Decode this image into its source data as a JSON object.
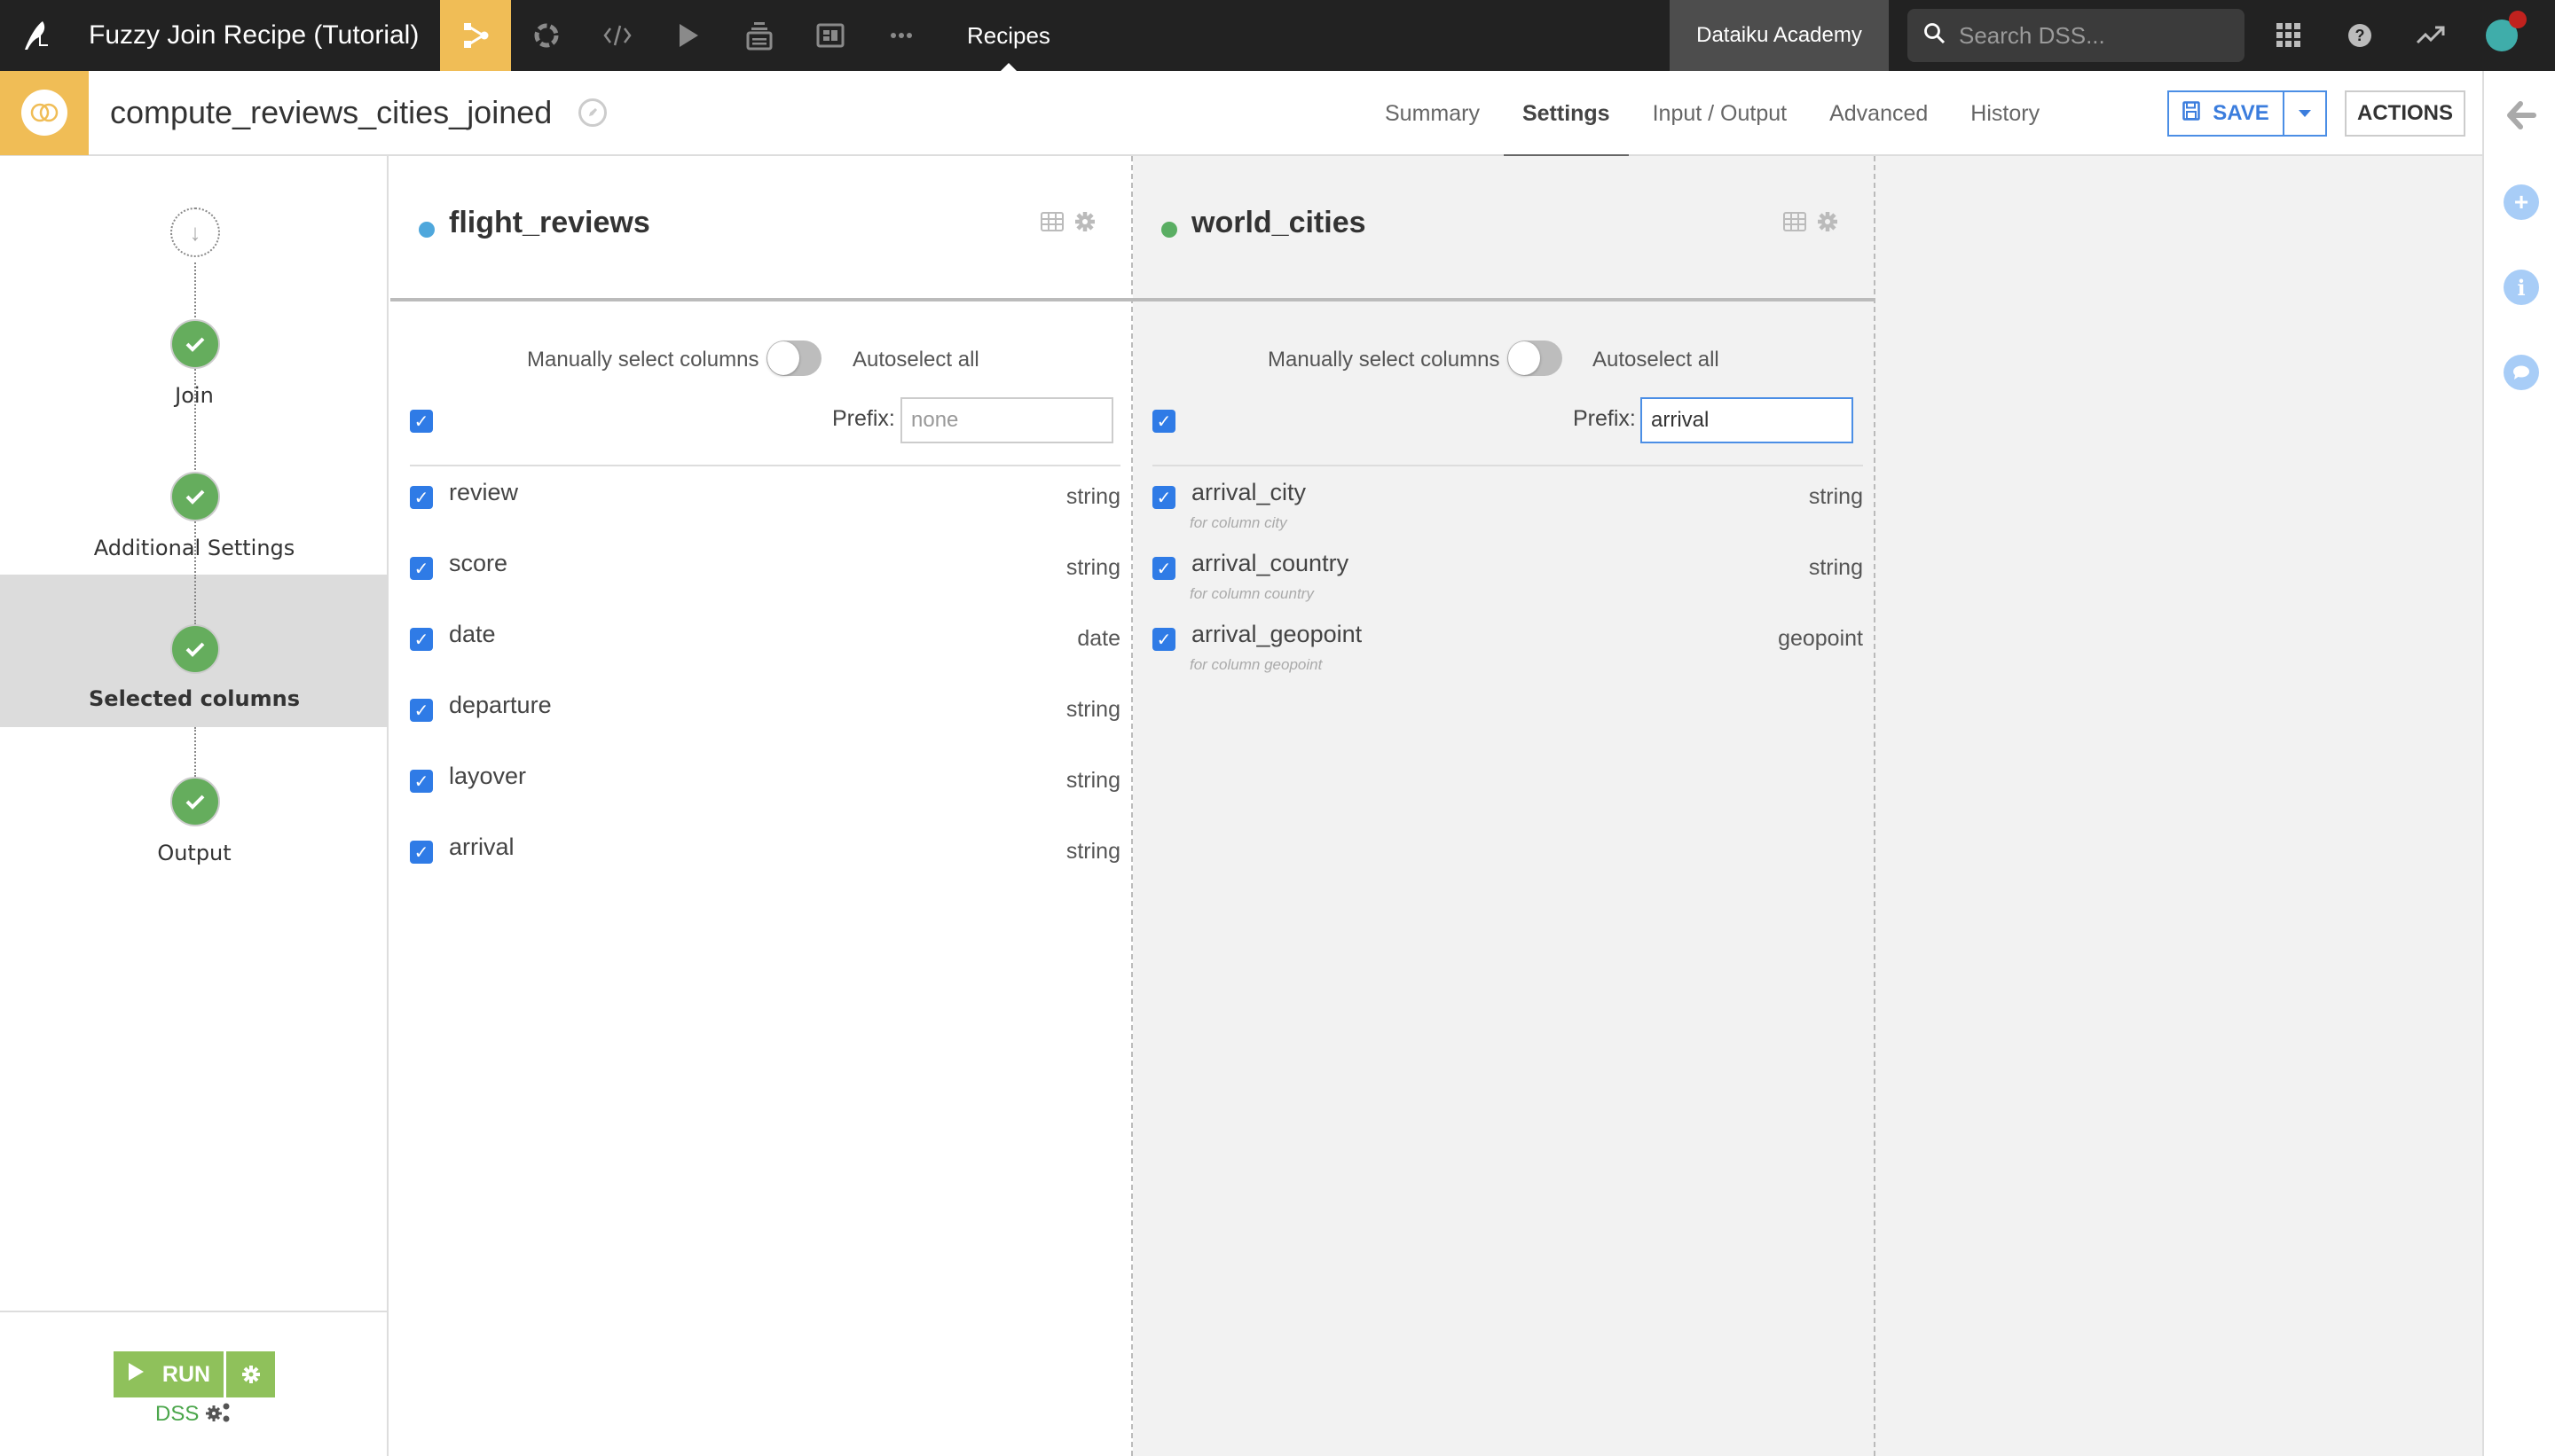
{
  "topbar": {
    "project_title": "Fuzzy Join Recipe (Tutorial)",
    "nav_icons": [
      "flow-icon",
      "jobs-icon",
      "code-icon",
      "run-icon",
      "datasets-icon",
      "dashboard-icon",
      "more-icon"
    ],
    "section_label": "Recipes",
    "instance_label": "Dataiku Academy",
    "search_placeholder": "Search DSS..."
  },
  "recipe_header": {
    "name": "compute_reviews_cities_joined",
    "tabs": [
      {
        "label": "Summary",
        "active": false
      },
      {
        "label": "Settings",
        "active": true
      },
      {
        "label": "Input / Output",
        "active": false
      },
      {
        "label": "Advanced",
        "active": false
      },
      {
        "label": "History",
        "active": false
      }
    ],
    "save_label": "SAVE",
    "actions_label": "ACTIONS"
  },
  "sidebar": {
    "steps": [
      {
        "label": "Join",
        "status": "done",
        "active": false
      },
      {
        "label": "Additional Settings",
        "status": "done",
        "active": false
      },
      {
        "label": "Selected columns",
        "status": "done",
        "active": true
      },
      {
        "label": "Output",
        "status": "done",
        "active": false
      }
    ],
    "run_label": "RUN",
    "engine_label": "DSS"
  },
  "panels": [
    {
      "dataset": "flight_reviews",
      "dot_color": "#4ea7dc",
      "manual_label": "Manually select columns",
      "auto_label": "Autoselect all",
      "toggle_on": false,
      "select_all_checked": true,
      "prefix_label": "Prefix:",
      "prefix_value": "",
      "prefix_placeholder": "none",
      "columns": [
        {
          "name": "review",
          "type": "string",
          "note": "",
          "checked": true
        },
        {
          "name": "score",
          "type": "string",
          "note": "",
          "checked": true
        },
        {
          "name": "date",
          "type": "date",
          "note": "",
          "checked": true
        },
        {
          "name": "departure",
          "type": "string",
          "note": "",
          "checked": true
        },
        {
          "name": "layover",
          "type": "string",
          "note": "",
          "checked": true
        },
        {
          "name": "arrival",
          "type": "string",
          "note": "",
          "checked": true
        }
      ]
    },
    {
      "dataset": "world_cities",
      "dot_color": "#5aae63",
      "manual_label": "Manually select columns",
      "auto_label": "Autoselect all",
      "toggle_on": false,
      "select_all_checked": true,
      "prefix_label": "Prefix:",
      "prefix_value": "arrival",
      "prefix_placeholder": "none",
      "columns": [
        {
          "name": "arrival_city",
          "type": "string",
          "note": "for column city",
          "checked": true
        },
        {
          "name": "arrival_country",
          "type": "string",
          "note": "for column country",
          "checked": true
        },
        {
          "name": "arrival_geopoint",
          "type": "geopoint",
          "note": "for column geopoint",
          "checked": true
        }
      ]
    }
  ],
  "colors": {
    "accent": "#f0bd56",
    "primary_blue": "#2f7be6",
    "success_green": "#65ad5d",
    "run_green": "#8fc15b"
  }
}
